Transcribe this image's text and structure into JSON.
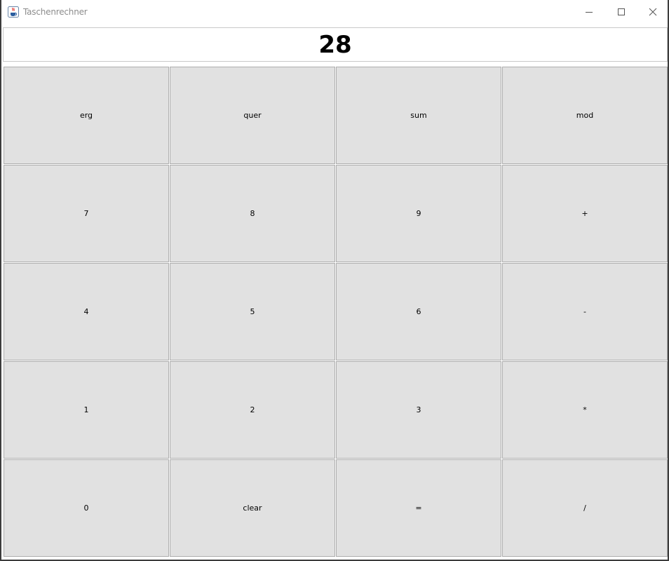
{
  "window": {
    "title": "Taschenrechner",
    "app_icon": "java-coffee-cup-icon",
    "controls": {
      "minimize_icon": "minimize-icon",
      "maximize_icon": "maximize-icon",
      "close_icon": "close-icon"
    }
  },
  "display": {
    "value": "28"
  },
  "keypad": {
    "rows": [
      [
        {
          "name": "erg",
          "label": "erg"
        },
        {
          "name": "quer",
          "label": "quer"
        },
        {
          "name": "sum",
          "label": "sum"
        },
        {
          "name": "mod",
          "label": "mod"
        }
      ],
      [
        {
          "name": "7",
          "label": "7"
        },
        {
          "name": "8",
          "label": "8"
        },
        {
          "name": "9",
          "label": "9"
        },
        {
          "name": "plus",
          "label": "+"
        }
      ],
      [
        {
          "name": "4",
          "label": "4"
        },
        {
          "name": "5",
          "label": "5"
        },
        {
          "name": "6",
          "label": "6"
        },
        {
          "name": "minus",
          "label": "-"
        }
      ],
      [
        {
          "name": "1",
          "label": "1"
        },
        {
          "name": "2",
          "label": "2"
        },
        {
          "name": "3",
          "label": "3"
        },
        {
          "name": "multiply",
          "label": "*"
        }
      ],
      [
        {
          "name": "0",
          "label": "0"
        },
        {
          "name": "clear",
          "label": "clear"
        },
        {
          "name": "equals",
          "label": "="
        },
        {
          "name": "divide",
          "label": "/"
        }
      ]
    ]
  },
  "colors": {
    "button_face": "#e1e1e1",
    "button_border": "#adadad",
    "window_border": "#3c3c3c",
    "title_text": "#8c8c8c"
  }
}
